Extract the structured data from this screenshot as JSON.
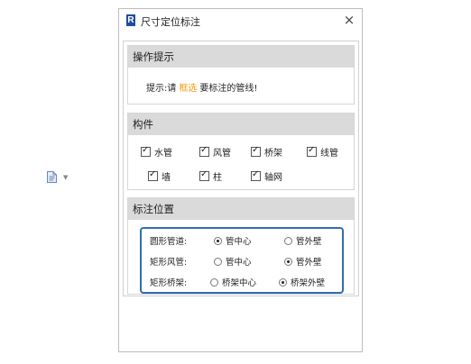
{
  "dialog": {
    "title": "尺寸定位标注",
    "logo_letter": "R",
    "close_glyph": "×"
  },
  "hint_section": {
    "header": "操作提示",
    "prefix": "提示:请",
    "link": "框选",
    "suffix": "要标注的管线!"
  },
  "components": {
    "header": "构件",
    "items": [
      {
        "label": "水管",
        "checked": true
      },
      {
        "label": "风管",
        "checked": true
      },
      {
        "label": "桥架",
        "checked": true
      },
      {
        "label": "线管",
        "checked": true
      },
      {
        "label": "墙",
        "checked": true
      },
      {
        "label": "柱",
        "checked": true
      },
      {
        "label": "轴网",
        "checked": true
      }
    ]
  },
  "position_section": {
    "header": "标注位置",
    "rows": [
      {
        "label": "圆形管道:",
        "option_a": "管中心",
        "option_b": "管外壁",
        "selected": "option_a"
      },
      {
        "label": "矩形风管:",
        "option_a": "管中心",
        "option_b": "管外壁",
        "selected": "option_b"
      },
      {
        "label": "矩形桥架:",
        "option_a": "桥架中心",
        "option_b": "桥架外壁",
        "selected": "option_b"
      }
    ]
  },
  "colors": {
    "accent": "#2f6db3",
    "hint_link": "#f39c12",
    "header_bg": "#dadada"
  }
}
